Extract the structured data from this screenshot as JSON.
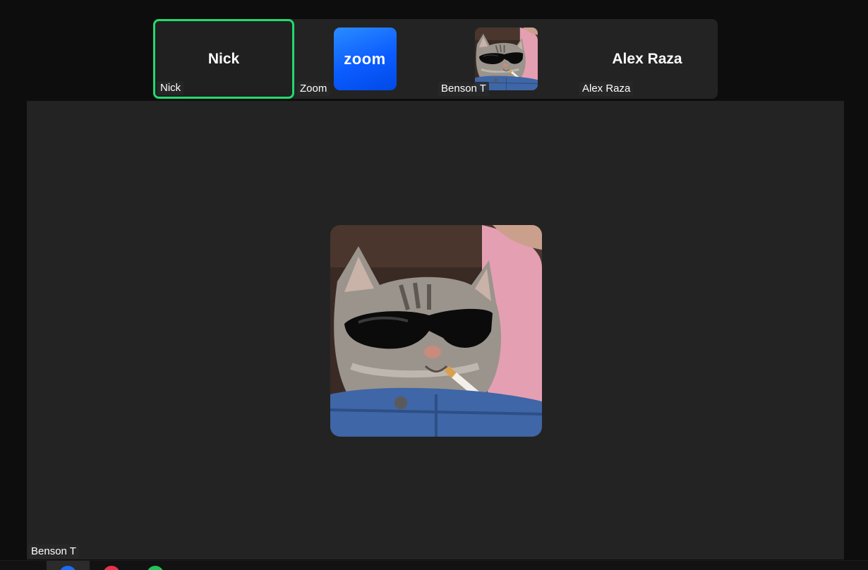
{
  "participants_strip": [
    {
      "tile_name": "Nick",
      "name_tag": "Nick",
      "kind": "text",
      "active": true
    },
    {
      "tile_name": "zoom",
      "name_tag": "Zoom",
      "kind": "logo",
      "active": false
    },
    {
      "tile_name": "",
      "name_tag": "Benson T",
      "kind": "avatar",
      "active": false
    },
    {
      "tile_name": "Alex Raza",
      "name_tag": "Alex Raza",
      "kind": "text",
      "active": false
    }
  ],
  "active_speaker": {
    "name_tag": "Benson T",
    "avatar_icon": "cat-sunglasses-avatar"
  },
  "colors": {
    "active_border": "#23d96c",
    "zoom_blue": "#0b5cff",
    "stage_bg": "#232323",
    "app_bg": "#0d0d0d"
  },
  "taskbar": {
    "icons": [
      "zoom-app-icon",
      "red-app-icon",
      "green-app-icon"
    ]
  }
}
